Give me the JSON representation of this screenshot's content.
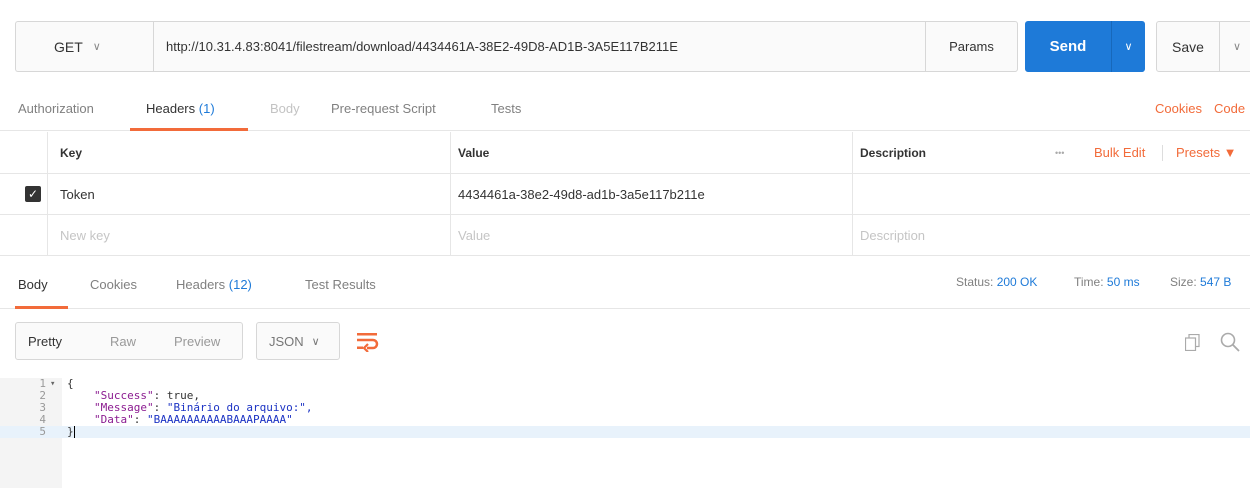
{
  "request": {
    "method": "GET",
    "url": "http://10.31.4.83:8041/filestream/download/4434461A-38E2-49D8-AD1B-3A5E117B211E",
    "params_label": "Params",
    "send_label": "Send",
    "save_label": "Save"
  },
  "request_tabs": {
    "authorization": "Authorization",
    "headers": "Headers",
    "headers_count": "(1)",
    "body": "Body",
    "prerequest": "Pre-request Script",
    "tests": "Tests",
    "cookies": "Cookies",
    "code": "Code"
  },
  "headers_table": {
    "col_key": "Key",
    "col_value": "Value",
    "col_description": "Description",
    "more": "•••",
    "bulk_edit": "Bulk Edit",
    "presets": "Presets ▼",
    "rows": [
      {
        "checked": true,
        "key": "Token",
        "value": "4434461a-38e2-49d8-ad1b-3a5e117b211e",
        "description": ""
      }
    ],
    "new_key_placeholder": "New key",
    "value_placeholder": "Value",
    "description_placeholder": "Description"
  },
  "response_tabs": {
    "body": "Body",
    "cookies": "Cookies",
    "headers": "Headers",
    "headers_count": "(12)",
    "test_results": "Test Results"
  },
  "response_status": {
    "status_label": "Status:",
    "status_value": "200 OK",
    "time_label": "Time:",
    "time_value": "50 ms",
    "size_label": "Size:",
    "size_value": "547 B"
  },
  "format": {
    "pretty": "Pretty",
    "raw": "Raw",
    "preview": "Preview",
    "language": "JSON"
  },
  "code": {
    "lines": [
      "1",
      "2",
      "3",
      "4",
      "5"
    ],
    "open_brace": "{",
    "close_brace": "}",
    "key1": "\"Success\"",
    "val1": "true,",
    "key2": "\"Message\"",
    "val2": "\"Binário do arquivo:\",",
    "key3": "\"Data\"",
    "val3": "\"BAAAAAAAAAABAAAPAAAA\""
  },
  "colors": {
    "accent_blue": "#1e7ad8",
    "accent_orange": "#f26b3a"
  }
}
